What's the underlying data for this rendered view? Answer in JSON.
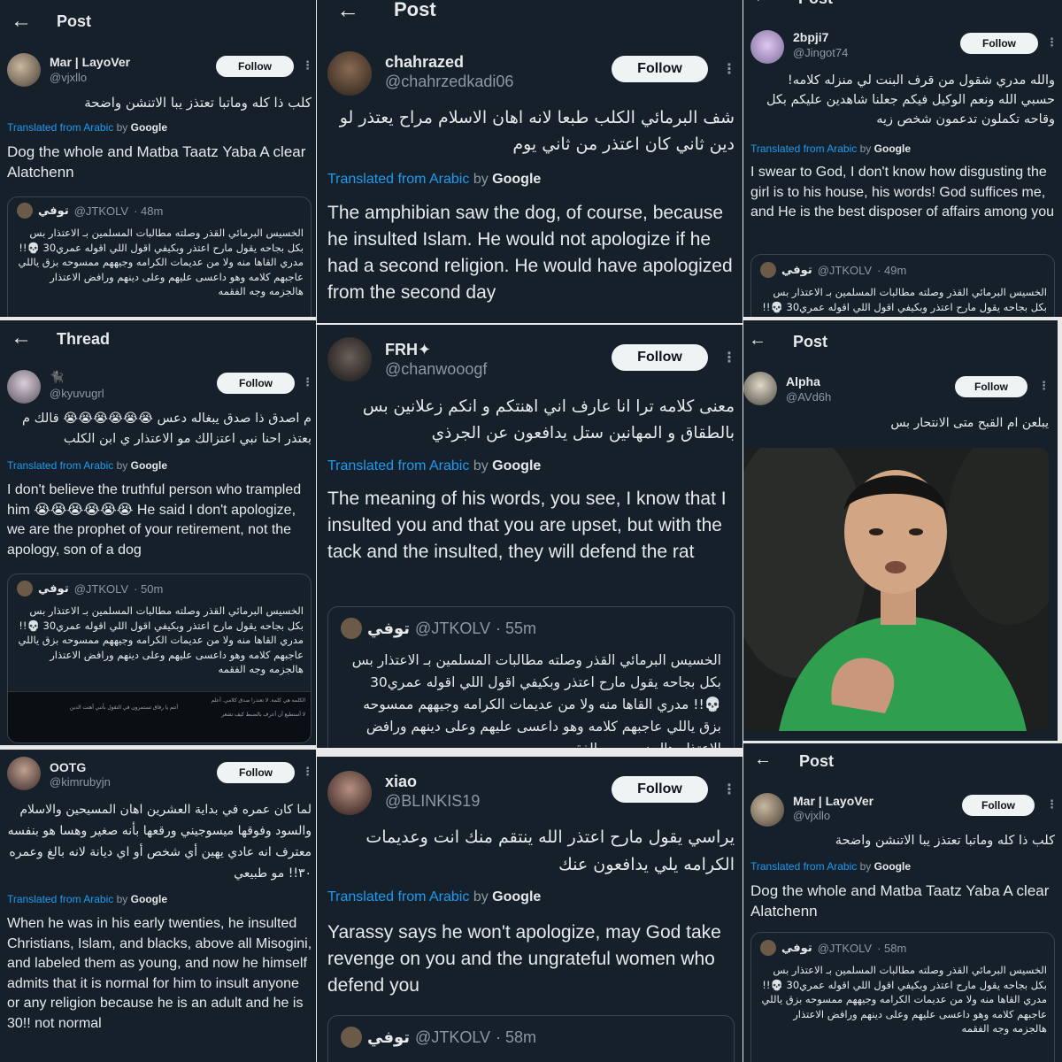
{
  "translate_prefix": "Translated from Arabic",
  "translate_by": "by",
  "translate_brand": "Google",
  "quote_handle_prefix": "@JTKOLV",
  "quote_name": "توفي",
  "quote_text": "الخسيس البرمائي القذر وصلته مطالبات المسلمين بـ الاعتذار بس بكل بجاحه يقول مارح اعتذر وبكيفي اقول اللي اقوله عمري30 💀!! مدري القاها منه ولا من عديمات الكرامه وجيههم ممسوحه بزق ياللي عاجبهم كلامه وهو داعسى عليهم وعلى دينهم ورافض الاعتذار هالجزمه وجه الفقمه",
  "follow_label": "Follow",
  "more_glyph": "⋮",
  "back_glyph": "←",
  "posts": [
    {
      "header": "Post",
      "name": "Mar | LayoVer",
      "handle": "@vjxllo",
      "arabic": "كلب ذا كله وماتبا تعتذز يبا الاتنشن واضحة",
      "english": "Dog the whole and Matba Taatz Yaba A clear Alatchenn",
      "quote_time": "· 48m"
    },
    {
      "header": "Post",
      "name": "chahrazed",
      "handle": "@chahrzedkadi06",
      "arabic": "شف البرمائي الكلب طبعا لانه اهان الاسلام مراح يعتذر لو دين ثاني كان اعتذر من ثاني يوم",
      "english": "The amphibian saw the dog, of course, because he insulted Islam. He would not apologize if he had a second religion. He would have apologized from the second day"
    },
    {
      "header": "Post",
      "name": "2bpji7",
      "handle": "@Jingot74",
      "arabic": "والله مدري شقول من قرف البنت لي منزله كلامه! حسبي الله ونعم الوكيل فيكم جعلنا شاهدين عليكم بكل وقاحه تكملون تدعمون شخص زيه",
      "english": "I swear to God, I don't know how disgusting the girl is to his house, his words! God suffices me, and He is the best disposer of affairs among you",
      "quote_time": "· 49m"
    },
    {
      "header": "Thread",
      "name": "🐈‍⬛",
      "handle": "@kyuvugrl",
      "arabic": "م اصدق ذا صدق يبغاله دعس 😭😭😭😭😭😭 قالك م بعتذر احنا نبي اعتزالك مو الاعتذار ي ابن الكلب",
      "english": "I don't believe the truthful person who trampled him 😭😭😭😭😭😭 He said I don't apologize, we are the prophet of your retirement, not the apology, son of a dog",
      "quote_time": "· 50m"
    },
    {
      "name": "FRH✦",
      "handle": "@chanwooogf",
      "arabic": "معنى كلامه ترا انا عارف اني اهنتكم و انكم زعلانين بس بالطقاق و المهانين ستل يدافعون عن الجرذي",
      "english": "The meaning of his words, you see, I know that I insulted you and that you are upset, but with the tack and the insulted, they will defend the rat",
      "quote_time": "· 55m"
    },
    {
      "header": "Post",
      "name": "Alpha",
      "handle": "@AVd6h",
      "arabic": "يبلعن ام القبح متى الانتحار بس"
    },
    {
      "name": "OOTG",
      "handle": "@kimrubyjn",
      "arabic": "لما كان عمره في بداية العشرين اهان المسيحين والاسلام والسود وفوقها ميسوجيني ورقعها بأنه صغير وهسا هو بنفسه معترف انه عادي يهين أي شخص أو اي ديانة لانه بالغ وعمره ٣٠!! مو طبيعي",
      "english": "When he was in his early twenties, he insulted Christians, Islam, and blacks, above all Misogini, and labeled them as young, and now he himself admits that it is normal for him to insult anyone or any religion because he is an adult and he is 30!! not normal"
    },
    {
      "name": "xiao",
      "handle": "@BLINKIS19",
      "arabic": "يراسي يقول مارح اعتذر الله ينتقم منك انت وعديمات الكرامه يلي يدافعون عنك",
      "english": "Yarassy says he won't apologize, may God take revenge on you and the ungrateful women who defend you",
      "quote_time": "· 58m"
    },
    {
      "header": "Post",
      "name": "Mar | LayoVer",
      "handle": "@vjxllo",
      "arabic": "كلب ذا كله وماتبا تعتذز يبا الاتنشن واضحة",
      "english": "Dog the whole and Matba Taatz Yaba A clear Alatchenn",
      "quote_time": "· 58m"
    }
  ],
  "media_snippets": {
    "a": "الكلمه هي كلمة. لا تعتذر! صدق كلامي. أعلم",
    "b": "أنتم يا رفاق تستمرون في التقول بأنني أهنت الدين",
    "c": "لا أستطيع أن أعرف بالضبط كيف تشعر"
  }
}
